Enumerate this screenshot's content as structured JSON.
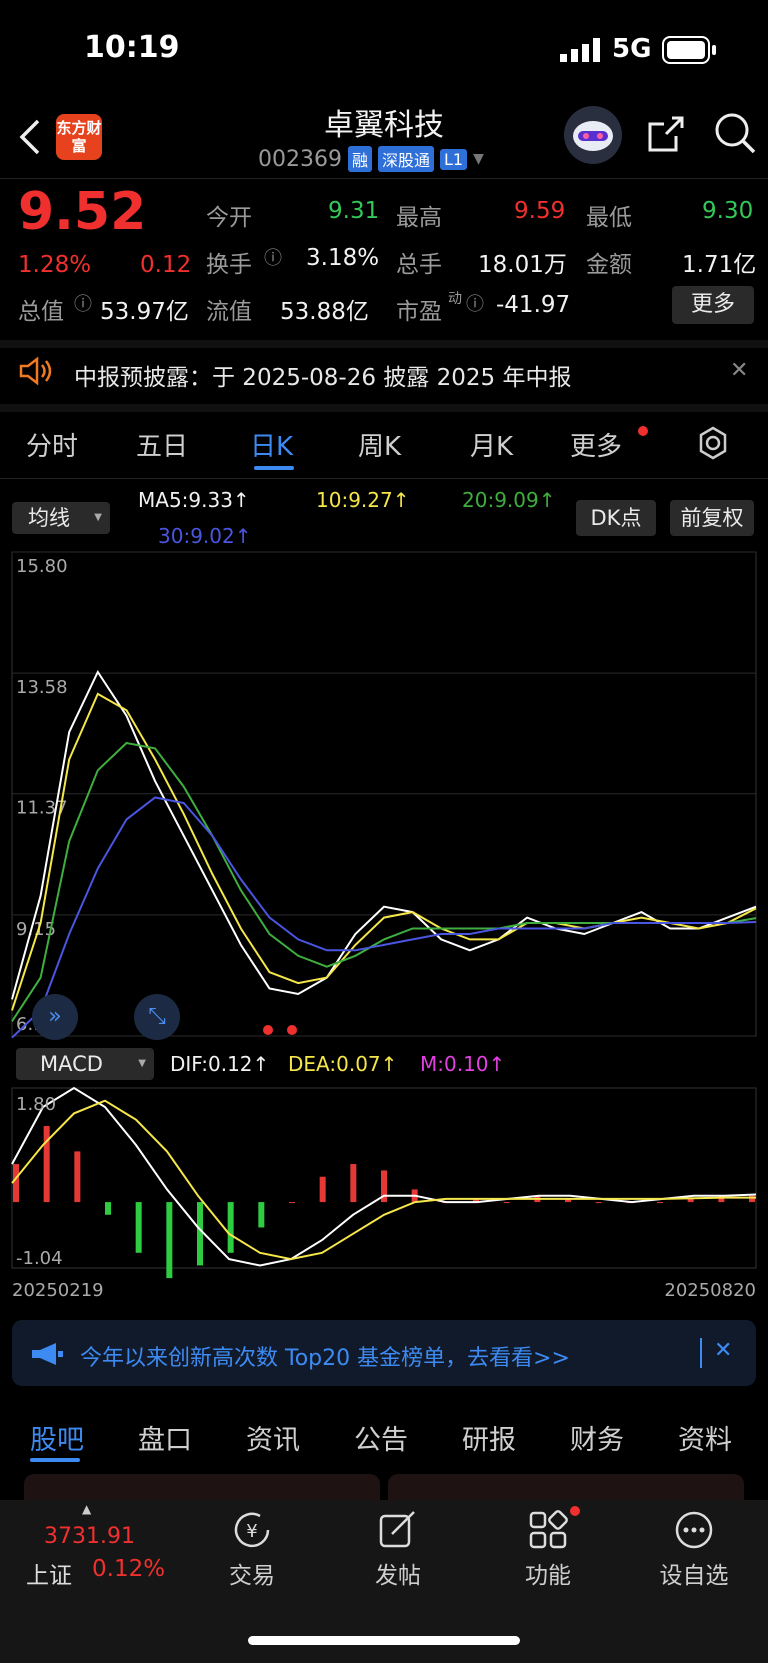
{
  "status_bar": {
    "time": "10:19",
    "network": "5G"
  },
  "header": {
    "logo_text": "东方财富",
    "stock_name": "卓翼科技",
    "stock_code": "002369",
    "tags": [
      "融",
      "深股通",
      "L1"
    ]
  },
  "quote": {
    "price": "9.52",
    "change_pct": "1.28%",
    "change": "0.12",
    "open_label": "今开",
    "open": "9.31",
    "high_label": "最高",
    "high": "9.59",
    "low_label": "最低",
    "low": "9.30",
    "turnover_label": "换手",
    "turnover": "3.18%",
    "volume_label": "总手",
    "volume": "18.01万",
    "amount_label": "金额",
    "amount": "1.71亿",
    "mktcap_label": "总值",
    "mktcap": "53.97亿",
    "float_label": "流值",
    "float_cap": "53.88亿",
    "pe_label": "市盈",
    "pe_sup": "动",
    "pe": "-41.97",
    "more_label": "更多"
  },
  "notice": {
    "text": "中报预披露：于 2025-08-26 披露 2025 年中报",
    "close": "✕"
  },
  "kline_tabs": [
    "分时",
    "五日",
    "日K",
    "周K",
    "月K",
    "更多"
  ],
  "ma_row": {
    "selector": "均线",
    "ma5": "MA5:9.33↑",
    "ma10": "10:9.27↑",
    "ma20": "20:9.09↑",
    "ma30": "30:9.02↑",
    "dk_label": "DK点",
    "adjust_label": "前复权"
  },
  "chart_data": {
    "type": "line",
    "title": "",
    "price_axis_labels": [
      "15.80",
      "13.58",
      "11.37",
      "9.15",
      "6.93"
    ],
    "ylim": [
      6.93,
      15.8
    ],
    "x_start": "20250219",
    "x_end": "20250820",
    "series": [
      {
        "name": "MA5",
        "color": "#ffffff",
        "values": [
          7.6,
          9.5,
          12.5,
          13.6,
          12.8,
          11.6,
          10.6,
          9.6,
          8.6,
          7.8,
          7.7,
          8.0,
          8.8,
          9.3,
          9.2,
          8.7,
          8.5,
          8.7,
          9.1,
          8.9,
          8.8,
          9.0,
          9.2,
          8.9,
          8.9,
          9.1,
          9.3
        ]
      },
      {
        "name": "MA10",
        "color": "#f5e64a",
        "values": [
          7.4,
          9.0,
          12.0,
          13.2,
          12.9,
          12.0,
          11.0,
          9.9,
          8.9,
          8.1,
          7.9,
          8.0,
          8.6,
          9.1,
          9.2,
          8.9,
          8.7,
          8.7,
          9.0,
          9.0,
          8.9,
          9.0,
          9.1,
          9.0,
          8.9,
          9.0,
          9.27
        ]
      },
      {
        "name": "MA20",
        "color": "#3fae3f",
        "values": [
          7.2,
          8.0,
          10.5,
          11.8,
          12.3,
          12.2,
          11.5,
          10.6,
          9.6,
          8.8,
          8.4,
          8.2,
          8.4,
          8.7,
          8.9,
          8.9,
          8.9,
          8.9,
          9.0,
          9.0,
          9.0,
          9.0,
          9.0,
          9.0,
          9.0,
          9.0,
          9.09
        ]
      },
      {
        "name": "MA30",
        "color": "#4a56e0",
        "values": [
          6.9,
          7.4,
          8.8,
          10.0,
          10.9,
          11.3,
          11.2,
          10.6,
          9.8,
          9.1,
          8.7,
          8.5,
          8.5,
          8.6,
          8.7,
          8.8,
          8.8,
          8.9,
          8.9,
          8.9,
          8.9,
          9.0,
          9.0,
          9.0,
          9.0,
          9.0,
          9.02
        ]
      }
    ],
    "macd": {
      "selector": "MACD",
      "dif": "DIF:0.12↑",
      "dea": "DEA:0.07↑",
      "m": "M:0.10↑",
      "axis_labels": [
        "1.80",
        "-1.04"
      ],
      "ylim": [
        -1.04,
        1.8
      ],
      "dif_values": [
        0.6,
        1.5,
        1.8,
        1.5,
        0.9,
        0.2,
        -0.4,
        -0.9,
        -1.0,
        -0.9,
        -0.6,
        -0.2,
        0.1,
        0.1,
        0.0,
        0.0,
        0.05,
        0.1,
        0.1,
        0.05,
        0.0,
        0.05,
        0.1,
        0.1,
        0.12
      ],
      "dea_values": [
        0.3,
        0.9,
        1.4,
        1.6,
        1.3,
        0.8,
        0.1,
        -0.5,
        -0.8,
        -0.9,
        -0.8,
        -0.5,
        -0.2,
        0.0,
        0.05,
        0.05,
        0.05,
        0.05,
        0.05,
        0.05,
        0.05,
        0.05,
        0.06,
        0.07,
        0.07
      ],
      "hist_values": [
        0.6,
        1.2,
        0.8,
        -0.2,
        -0.8,
        -1.2,
        -1.0,
        -0.8,
        -0.4,
        0.0,
        0.4,
        0.6,
        0.5,
        0.2,
        0.0,
        0.05,
        0.0,
        0.1,
        0.05,
        0.0,
        0.0,
        0.0,
        0.05,
        0.1,
        0.1
      ]
    }
  },
  "banner": {
    "text": "今年以来创新高次数 Top20 基金榜单，去看看>>"
  },
  "sub_tabs": [
    "股吧",
    "盘口",
    "资讯",
    "公告",
    "研报",
    "财务",
    "资料"
  ],
  "bottom_nav": {
    "index_value": "3731.91",
    "index_name": "上证",
    "index_change": "0.12%",
    "items": [
      "交易",
      "发帖",
      "功能",
      "设自选"
    ]
  }
}
